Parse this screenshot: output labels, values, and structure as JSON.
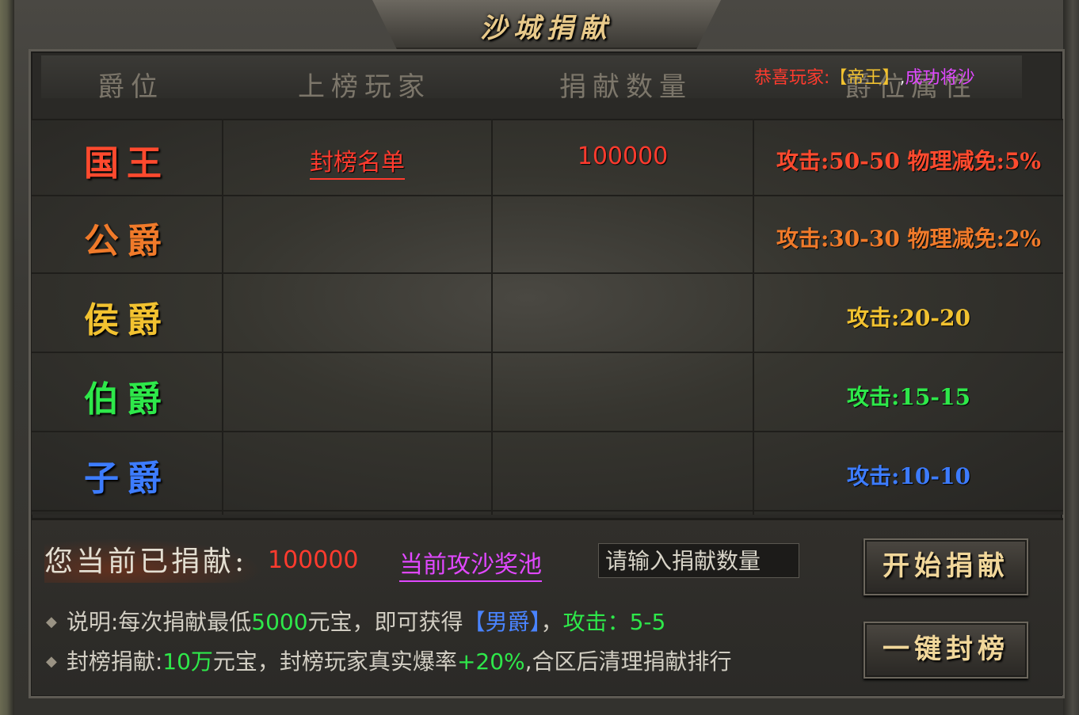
{
  "title": "沙城捐献",
  "header": {
    "col_rank": "爵位",
    "col_player": "上榜玩家",
    "col_amount": "捐献数量",
    "col_attr": "爵位属性"
  },
  "marquee": {
    "part1": "恭喜玩家:",
    "part2": "【帝王】",
    "part3": ",",
    "part4": "成功将沙"
  },
  "rows": [
    {
      "rank": "国王",
      "player": "封榜名单",
      "amount": "100000",
      "attr": "攻击:50-50 物理减免:5%",
      "color": "#ff4a2e"
    },
    {
      "rank": "公爵",
      "player": "",
      "amount": "",
      "attr": "攻击:30-30 物理减免:2%",
      "color": "#f07a2a"
    },
    {
      "rank": "侯爵",
      "player": "",
      "amount": "",
      "attr": "攻击:20-20",
      "color": "#f2c230"
    },
    {
      "rank": "伯爵",
      "player": "",
      "amount": "",
      "attr": "攻击:15-15",
      "color": "#2ee84a"
    },
    {
      "rank": "子爵",
      "player": "",
      "amount": "",
      "attr": "攻击:10-10",
      "color": "#3d7cff"
    }
  ],
  "bottom": {
    "donated_label": "您当前已捐献:",
    "donated_value": "100000",
    "pool_link": "当前攻沙奖池",
    "input_placeholder": "请输入捐献数量",
    "btn_donate": "开始捐献",
    "btn_seal": "一键封榜",
    "note1": {
      "a": "说明:每次捐献最低",
      "b": "5000",
      "c": "元宝，即可获得",
      "d": "【男爵】",
      "e": "，",
      "f": "攻击：5-5"
    },
    "note2": {
      "a": "封榜捐献:",
      "b": "10万",
      "c": "元宝，封榜玩家真实爆率",
      "d": "+20%",
      "e": ",合区后清理捐献排行"
    }
  }
}
